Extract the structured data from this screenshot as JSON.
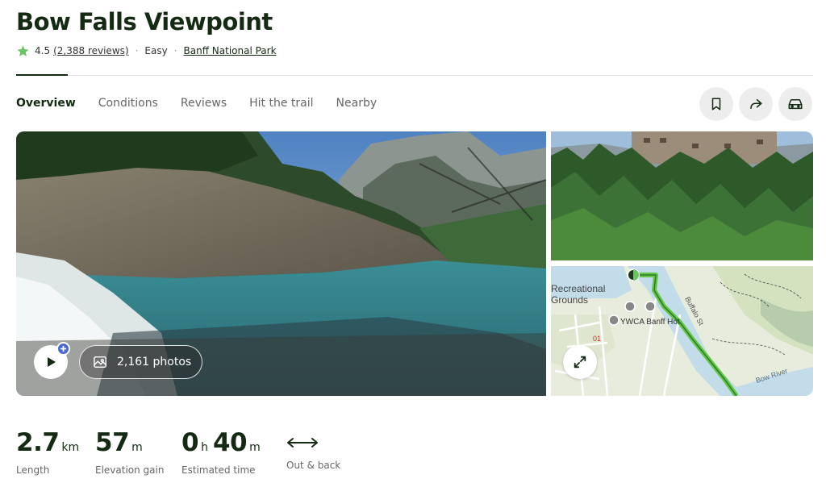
{
  "title": "Bow Falls Viewpoint",
  "rating": {
    "score": "4.5",
    "reviews": "(2,388 reviews)",
    "icon": "star-icon",
    "star_color": "#67c562"
  },
  "difficulty": "Easy",
  "separator": "·",
  "park": "Banff National Park",
  "tabs": [
    {
      "label": "Overview",
      "active": true
    },
    {
      "label": "Conditions"
    },
    {
      "label": "Reviews"
    },
    {
      "label": "Hit the trail"
    },
    {
      "label": "Nearby"
    }
  ],
  "actions": [
    "bookmark-icon",
    "share-icon",
    "car-icon"
  ],
  "media": {
    "photos_label": "2,161 photos",
    "map_labels": {
      "recreational": "Recreational",
      "grounds": "Grounds",
      "ywca": "YWCA Banff Hot",
      "street": "Buffalo St",
      "river": "Bow River",
      "marker": "01"
    }
  },
  "stats": [
    {
      "value": "2.7",
      "unit": "km",
      "label": "Length"
    },
    {
      "value": "57",
      "unit": "m",
      "label": "Elevation gain"
    },
    {
      "value_h": "0",
      "unit_h": "h",
      "value_m": "40",
      "unit_m": "m",
      "label": "Estimated time"
    },
    {
      "label": "Out & back",
      "icon": "out-and-back-icon"
    }
  ],
  "colors": {
    "brand_dark": "#142a12",
    "trail_green": "#64c845",
    "badge_blue": "#4a67d6"
  }
}
